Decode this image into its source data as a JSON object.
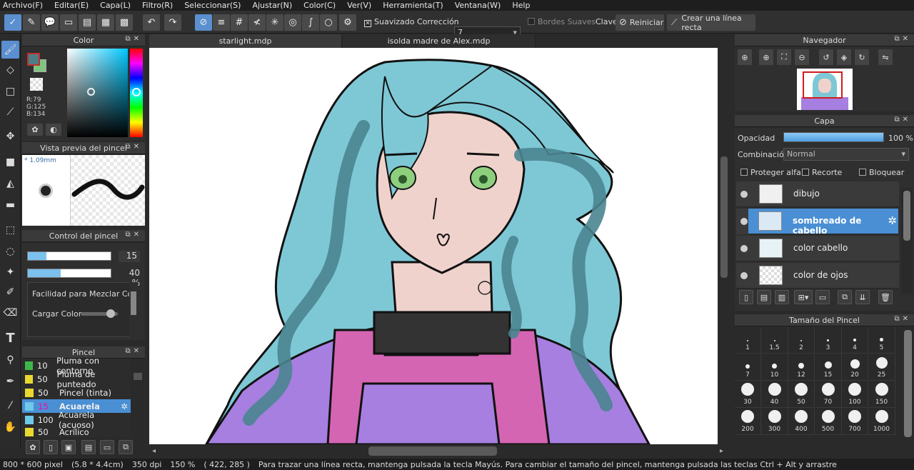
{
  "menu": [
    "Archivo(F)",
    "Editar(E)",
    "Capa(L)",
    "Filtro(R)",
    "Seleccionar(S)",
    "Ajustar(N)",
    "Color(C)",
    "Ver(V)",
    "Herramienta(T)",
    "Ventana(W)",
    "Help"
  ],
  "toolbar": {
    "smoothing_label": "Suavizado",
    "correction_label": "Corrección",
    "correction_value": "7",
    "soft_edges_label": "Bordes Suaves",
    "key_label": "Clave",
    "reset_label": "Reiniciar",
    "straight_line_label": "Crear una línea recta"
  },
  "color_panel": {
    "title": "Color",
    "r": "R:79",
    "g": "G:125",
    "b": "B:134",
    "fg_color": "#4f7d86",
    "bg_color": "#7ec67e"
  },
  "brush_preview": {
    "title": "Vista previa del pincel",
    "size_label": "* 1.09mm"
  },
  "brush_control": {
    "title": "Control del pincel",
    "size_value": "15",
    "opacity_value": "40 %",
    "size_fraction": 0.22,
    "opacity_fraction": 0.4,
    "mix_label": "Facilidad para Mezclar Color",
    "load_label": "Cargar Color",
    "load_fraction": 0.62
  },
  "brush_list": {
    "title": "Pincel",
    "items": [
      {
        "size": "10",
        "name": "Pluma con contorno",
        "color": "#3cb84a"
      },
      {
        "size": "50",
        "name": "Pluma de punteado",
        "color": "#e8d830"
      },
      {
        "size": "50",
        "name": "Pincel (tinta)",
        "color": "#e8d830"
      },
      {
        "size": "15",
        "name": "Acuarela",
        "color": "#6ec8e8",
        "selected": true
      },
      {
        "size": "100",
        "name": "Acuarela (acuoso)",
        "color": "#6ec8e8"
      },
      {
        "size": "50",
        "name": "Acrílico",
        "color": "#e8d830"
      }
    ]
  },
  "tabs": [
    "starlight.mdp",
    "isolda madre de Alex.mdp"
  ],
  "navigator": {
    "title": "Navegador"
  },
  "layers": {
    "title": "Capa",
    "opacity_label": "Opacidad",
    "opacity_value": "100 %",
    "opacity_fraction": 1.0,
    "blend_label": "Combinación",
    "blend_value": "Normal",
    "protect_alpha": "Proteger alfa",
    "clipping": "Recorte",
    "lock": "Bloquear",
    "items": [
      {
        "name": "dibujo",
        "selected": false
      },
      {
        "name": "sombreado de cabello",
        "selected": true
      },
      {
        "name": "color cabello",
        "selected": false
      },
      {
        "name": "color de ojos",
        "selected": false
      }
    ]
  },
  "brush_size": {
    "title": "Tamaño del Pincel",
    "sizes": [
      "1",
      "1.5",
      "2",
      "3",
      "4",
      "5",
      "7",
      "10",
      "12",
      "15",
      "20",
      "25",
      "30",
      "40",
      "50",
      "70",
      "100",
      "150",
      "200",
      "300",
      "400",
      "500",
      "700",
      "1000"
    ]
  },
  "status": {
    "dims": "800 * 600 pixel",
    "physical": "(5.8 * 4.4cm)",
    "dpi": "350 dpi",
    "zoom": "150 %",
    "coords": "( 422, 285 )",
    "hint": "Para trazar una línea recta, mantenga pulsada la tecla Mayús. Para cambiar el tamaño del pincel, mantenga pulsada las teclas Ctrl + Alt y arrastre"
  }
}
